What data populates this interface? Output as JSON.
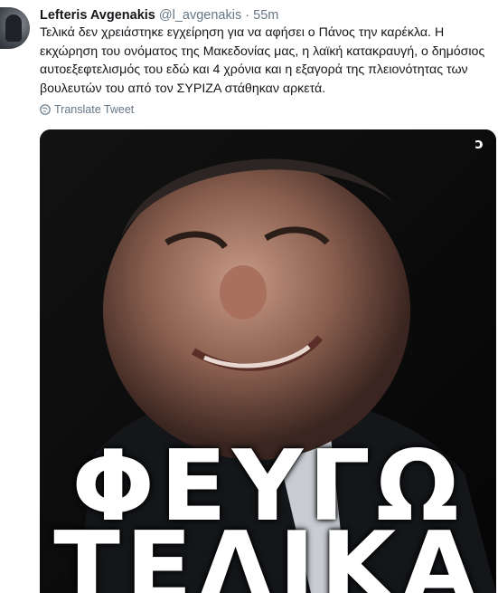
{
  "tweet": {
    "author_name": "Lefteris Avgenakis",
    "author_handle": "@l_avgenakis",
    "separator": "·",
    "time": "55m",
    "text": "Τελικά δεν χρειάστηκε εγχείρηση για να αφήσει ο Πάνος την καρέκλα. Η εκχώρηση του ονόματος της Μακεδονίας μας, η λαϊκή κατακραυγή, ο δημόσιος αυτοεξεφτελισμός του εδώ και 4 χρόνια και η εξαγορά της πλειονότητας των βουλευτών του από τον ΣΥΡΙΖΑ στάθηκαν αρκετά.",
    "translate_label": "Translate Tweet",
    "translate_icon": "globe-icon"
  },
  "media": {
    "overlay_line_1": "ΦΕΥΓΩ",
    "overlay_line_2": "ΤΕΛΙΚΑ",
    "watermark": "ɔ"
  },
  "colors": {
    "text": "#14171a",
    "secondary": "#657786",
    "media_bg": "#0b0b0b"
  }
}
